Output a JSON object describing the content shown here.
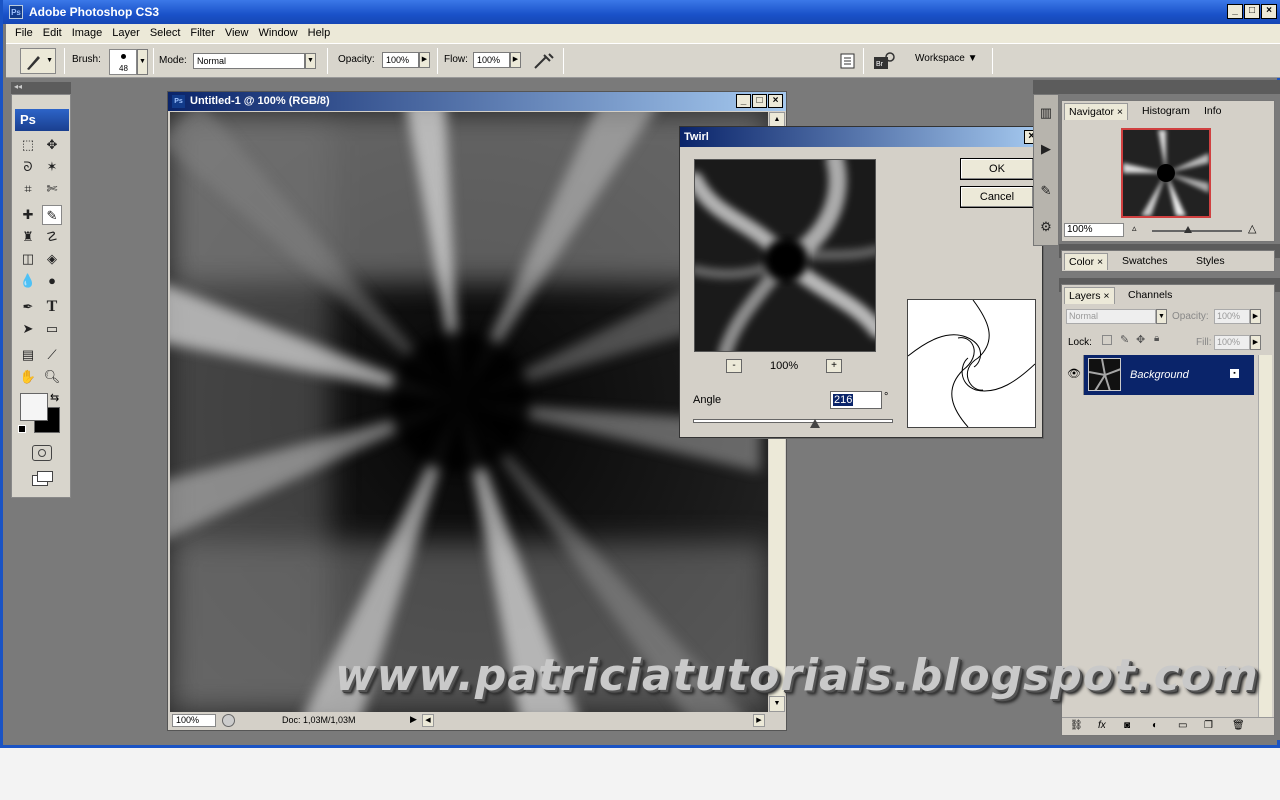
{
  "app": {
    "title": "Adobe Photoshop CS3",
    "logo": "Ps"
  },
  "menu": [
    "File",
    "Edit",
    "Image",
    "Layer",
    "Select",
    "Filter",
    "View",
    "Window",
    "Help"
  ],
  "options": {
    "brush_label": "Brush:",
    "brush_size": "48",
    "mode_label": "Mode:",
    "mode_value": "Normal",
    "opacity_label": "Opacity:",
    "opacity_value": "100%",
    "flow_label": "Flow:",
    "flow_value": "100%",
    "workspace_label": "Workspace"
  },
  "toolbox": {
    "logo": "Ps"
  },
  "document": {
    "title": "Untitled-1 @ 100% (RGB/8)",
    "zoom": "100%",
    "doc_info": "Doc: 1,03M/1,03M"
  },
  "dialog": {
    "title": "Twirl",
    "ok": "OK",
    "cancel": "Cancel",
    "zoom": "100%",
    "minus": "-",
    "plus": "+",
    "angle_label": "Angle",
    "angle_value": "216",
    "angle_unit": "°",
    "angle_min": -999,
    "angle_max": 999
  },
  "navigator": {
    "tabs": [
      "Navigator",
      "Histogram",
      "Info"
    ],
    "zoom": "100%"
  },
  "color_panel": {
    "tabs": [
      "Color",
      "Swatches",
      "Styles"
    ]
  },
  "layers_panel": {
    "tabs": [
      "Layers",
      "Channels"
    ],
    "blend_mode": "Normal",
    "opacity_label": "Opacity:",
    "opacity_value": "100%",
    "lock_label": "Lock:",
    "fill_label": "Fill:",
    "fill_value": "100%",
    "layers": [
      {
        "name": "Background"
      }
    ]
  },
  "watermark": "www.patriciatutoriais.blogspot.com",
  "colors": {
    "title_blue": "#1a52c9",
    "selected_layer": "#0a246a",
    "panel_bg": "#d4d0c8"
  }
}
